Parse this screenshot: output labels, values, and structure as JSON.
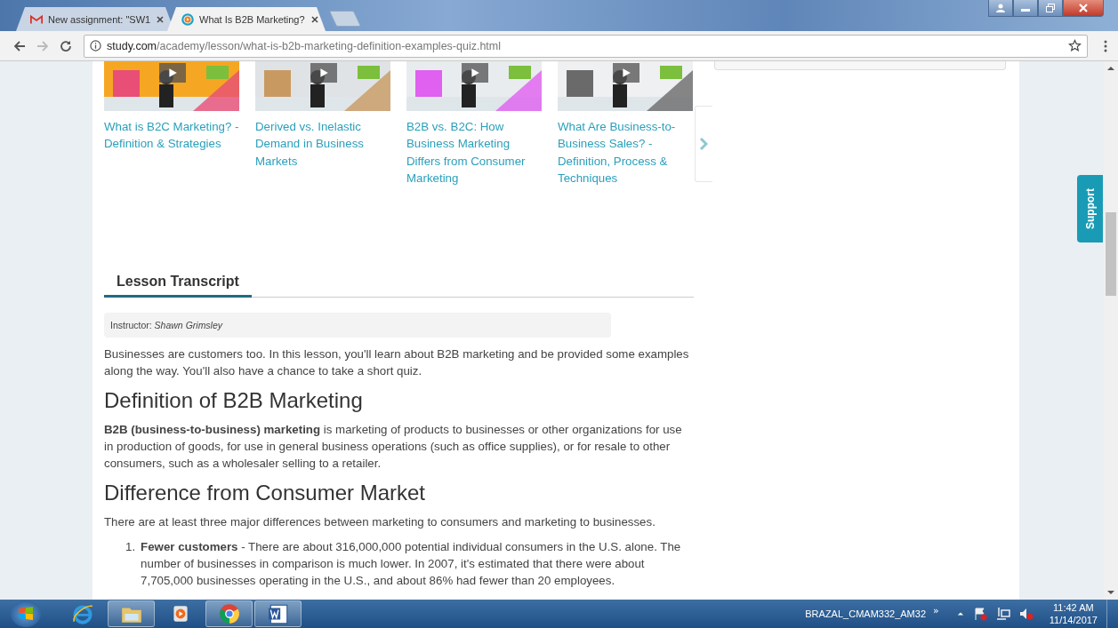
{
  "browser": {
    "tabs": [
      {
        "title": "New assignment: \"SW1",
        "selected": false
      },
      {
        "title": "What Is B2B Marketing?",
        "selected": true
      }
    ],
    "address": {
      "domain": "study.com",
      "path": "/academy/lesson/what-is-b2b-marketing-definition-examples-quiz.html"
    }
  },
  "related_videos": [
    {
      "title": "What is B2C Marketing? - Definition & Strategies"
    },
    {
      "title": "Derived vs. Inelastic Demand in Business Markets"
    },
    {
      "title": "B2B vs. B2C: How Business Marketing Differs from Consumer Marketing"
    },
    {
      "title": "What Are Business-to-Business Sales? - Definition, Process & Techniques"
    }
  ],
  "support_tab": "Support",
  "transcript": {
    "tab": "Lesson Transcript",
    "instructor": "Instructor: *Shawn Grimsley*",
    "blocks": [
      {
        "kind": "paragraph",
        "text": "Businesses are customers too. In this lesson, you'll learn about B2B marketing and be provided some examples along the way. You'll also have a chance to take a short quiz."
      },
      {
        "kind": "heading",
        "text": "Definition of B2B Marketing"
      },
      {
        "kind": "paragraph",
        "text": "**B2B (business-to-business) marketing** is marketing of products to businesses or other organizations for use in production of goods, for use in general business operations (such as office supplies), or for resale to other consumers, such as a wholesaler selling to a retailer."
      },
      {
        "kind": "heading",
        "text": "Difference from Consumer Market"
      },
      {
        "kind": "paragraph",
        "text": "There are at least three major differences between marketing to consumers and marketing to businesses."
      },
      {
        "kind": "list_item",
        "number": "1.",
        "text": "**Fewer customers** - There are about 316,000,000 potential individual consumers in the U.S. alone. The number of businesses in comparison is much lower. In 2007, it's estimated that there were about 7,705,000 businesses operating in the U.S., and about 86% had fewer than 20 employees."
      }
    ]
  },
  "taskbar": {
    "apps": [
      {
        "kind": "ie",
        "running": false
      },
      {
        "kind": "explorer",
        "running": true
      },
      {
        "kind": "media",
        "running": false
      },
      {
        "kind": "chrome",
        "running": true
      },
      {
        "kind": "word",
        "running": true
      }
    ],
    "user": "BRAZAL_CMAM332_AM32",
    "overflow": "»",
    "time": "11:42 AM",
    "date": "11/14/2017"
  }
}
